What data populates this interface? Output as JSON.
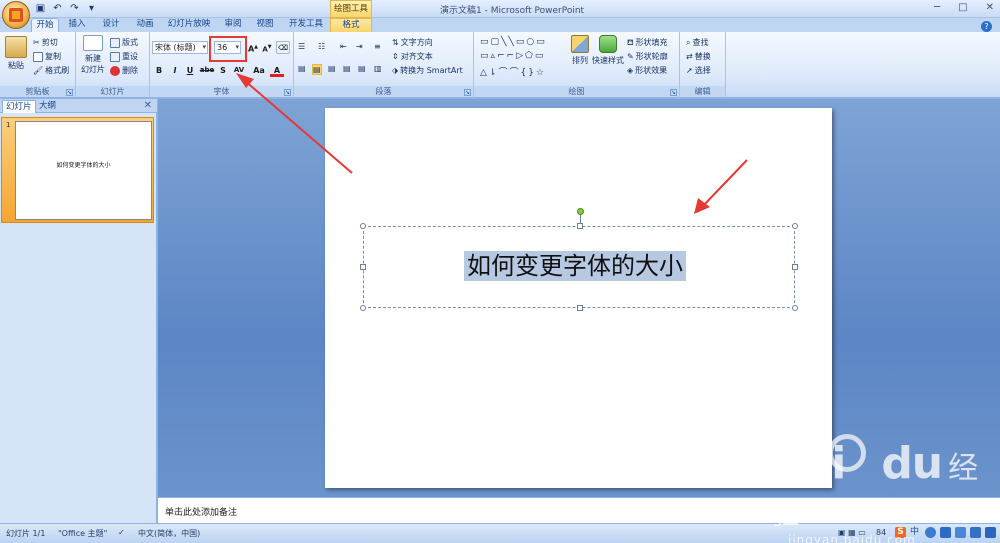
{
  "window": {
    "title": "演示文稿1 - Microsoft PowerPoint",
    "context_label": "绘图工具"
  },
  "tabs": [
    {
      "label": "开始",
      "active": true
    },
    {
      "label": "插入"
    },
    {
      "label": "设计"
    },
    {
      "label": "动画"
    },
    {
      "label": "幻灯片放映"
    },
    {
      "label": "审阅"
    },
    {
      "label": "视图"
    },
    {
      "label": "开发工具"
    },
    {
      "label": "格式",
      "context": true
    }
  ],
  "ribbon": {
    "clipboard": {
      "label": "剪贴板",
      "paste": "粘贴",
      "cut": "剪切",
      "copy": "复制",
      "format_painter": "格式刷"
    },
    "slides": {
      "label": "幻灯片",
      "new_slide_1": "新建",
      "new_slide_2": "幻灯片",
      "layout": "版式",
      "reset": "重设",
      "delete": "删除"
    },
    "font": {
      "label": "字体",
      "font_name": "宋体 (标题)",
      "font_size": "36",
      "bold": "B",
      "italic": "I",
      "underline": "U",
      "strike": "abe",
      "shadow": "S",
      "spacing": "AV",
      "case": "Aa",
      "color": "A"
    },
    "paragraph": {
      "label": "段落",
      "text_direction": "文字方向",
      "align_text": "对齐文本",
      "smartart": "转换为 SmartArt"
    },
    "drawing": {
      "label": "绘图",
      "arrange": "排列",
      "quick_styles": "快速样式",
      "shape_fill": "形状填充",
      "shape_outline": "形状轮廓",
      "shape_effects": "形状效果"
    },
    "editing": {
      "label": "编辑",
      "find": "查找",
      "replace": "替换",
      "select": "选择"
    }
  },
  "left_pane": {
    "tab_slides": "幻灯片",
    "tab_outline": "大纲",
    "slide_number": "1",
    "thumb_text": "如何变更字体的大小"
  },
  "slide": {
    "title_text": "如何变更字体的大小"
  },
  "notes": {
    "placeholder": "单击此处添加备注"
  },
  "status": {
    "slide_info": "幻灯片 1/1",
    "theme": "\"Office 主题\"",
    "language": "中文(简体，中国)",
    "zoom": "84",
    "ime": "S",
    "ime_mode": "中"
  },
  "watermark": {
    "brand": "Bai",
    "brand2": "du",
    "cn": "经验",
    "url": "jingyan.baidu.com"
  },
  "colors": {
    "accent_red": "#e53935",
    "ribbon_blue": "#15428b",
    "selected_thumb": "#f4a634"
  }
}
